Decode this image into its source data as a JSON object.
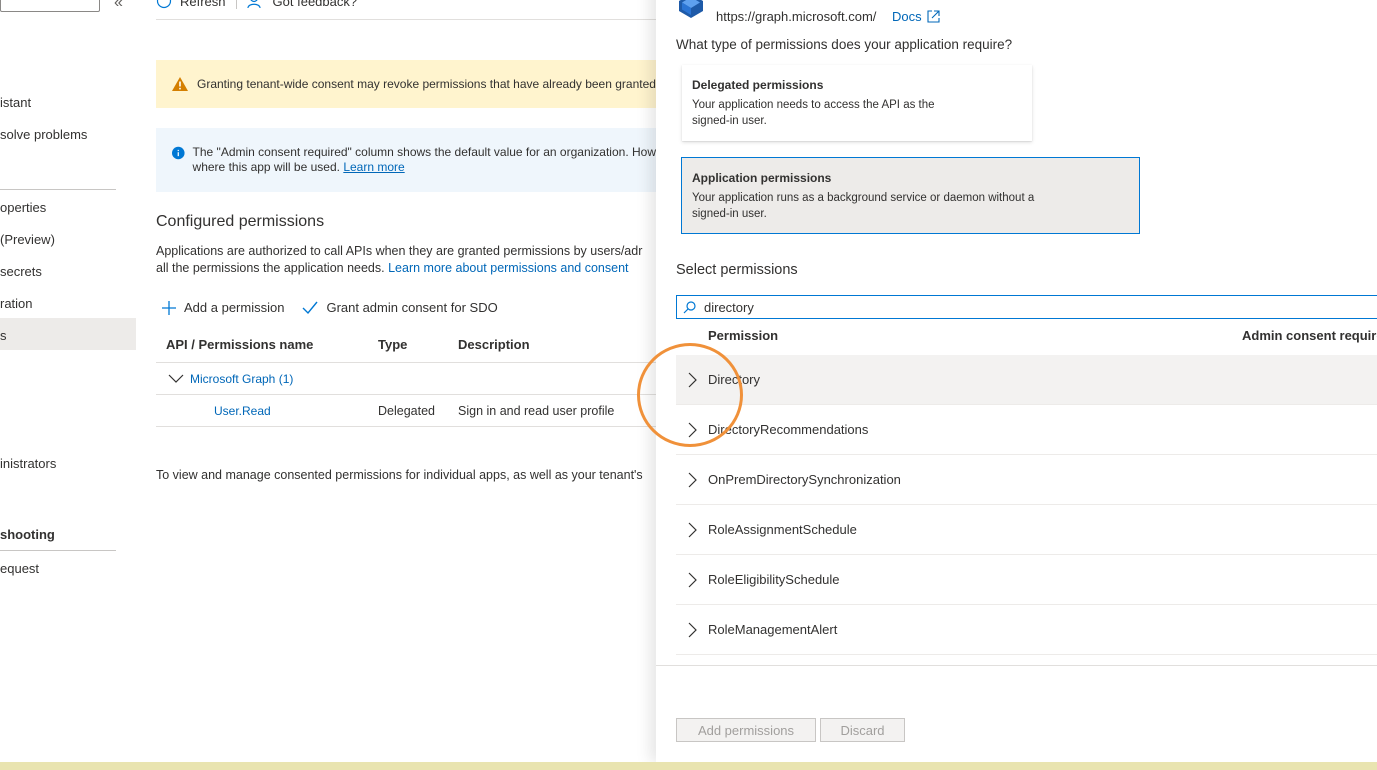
{
  "nav": {
    "collapse_glyph": "«",
    "items": [
      {
        "label": "istant",
        "top": 0
      },
      {
        "label": "solve problems"
      },
      {
        "label": "operties"
      },
      {
        "label": " (Preview)"
      },
      {
        "label": "secrets"
      },
      {
        "label": "ration"
      },
      {
        "label": "s"
      },
      {
        "label": "inistrators"
      },
      {
        "label": "shooting"
      },
      {
        "label": "equest"
      }
    ]
  },
  "toolbar": {
    "refresh": "Refresh",
    "feedback": "Got feedback?"
  },
  "banners": {
    "warning": "Granting tenant-wide consent may revoke permissions that have already been granted",
    "info_line1": "The \"Admin consent required\" column shows the default value for an organization. How",
    "info_line2_prefix": "where this app will be used.",
    "info_link": "Learn more"
  },
  "configured": {
    "title": "Configured permissions",
    "desc_line1": "Applications are authorized to call APIs when they are granted permissions by users/adr",
    "desc_line2_prefix": "all the permissions the application needs.",
    "desc_link": "Learn more about permissions and consent",
    "add_permission": "Add a permission",
    "grant_consent": "Grant admin consent for SDO",
    "columns": [
      "API / Permissions name",
      "Type",
      "Description"
    ],
    "group": "Microsoft Graph (1)",
    "rows": [
      {
        "name": "User.Read",
        "type": "Delegated",
        "description": "Sign in and read user profile"
      }
    ],
    "footer": "To view and manage consented permissions for individual apps, as well as your tenant's"
  },
  "panel": {
    "api_url": "https://graph.microsoft.com/",
    "docs": "Docs",
    "question": "What type of permissions does your application require?",
    "delegated": {
      "title": "Delegated permissions",
      "line1": "Your application needs to access the API as the",
      "line2": "signed-in user."
    },
    "application": {
      "title": "Application permissions",
      "line1": "Your application runs as a background service or daemon without a",
      "line2": "signed-in user."
    },
    "select_title": "Select permissions",
    "search_value": "directory",
    "col_permission": "Permission",
    "col_admin": "Admin consent require",
    "permissions": [
      "Directory",
      "DirectoryRecommendations",
      "OnPremDirectorySynchronization",
      "RoleAssignmentSchedule",
      "RoleEligibilitySchedule",
      "RoleManagementAlert"
    ],
    "add_button": "Add permissions",
    "discard_button": "Discard"
  },
  "colors": {
    "accent": "#0078d4",
    "link": "#0067b8",
    "warning_bg": "#fff4ce",
    "info_bg": "#eff6fc",
    "highlight": "#f0913a"
  }
}
